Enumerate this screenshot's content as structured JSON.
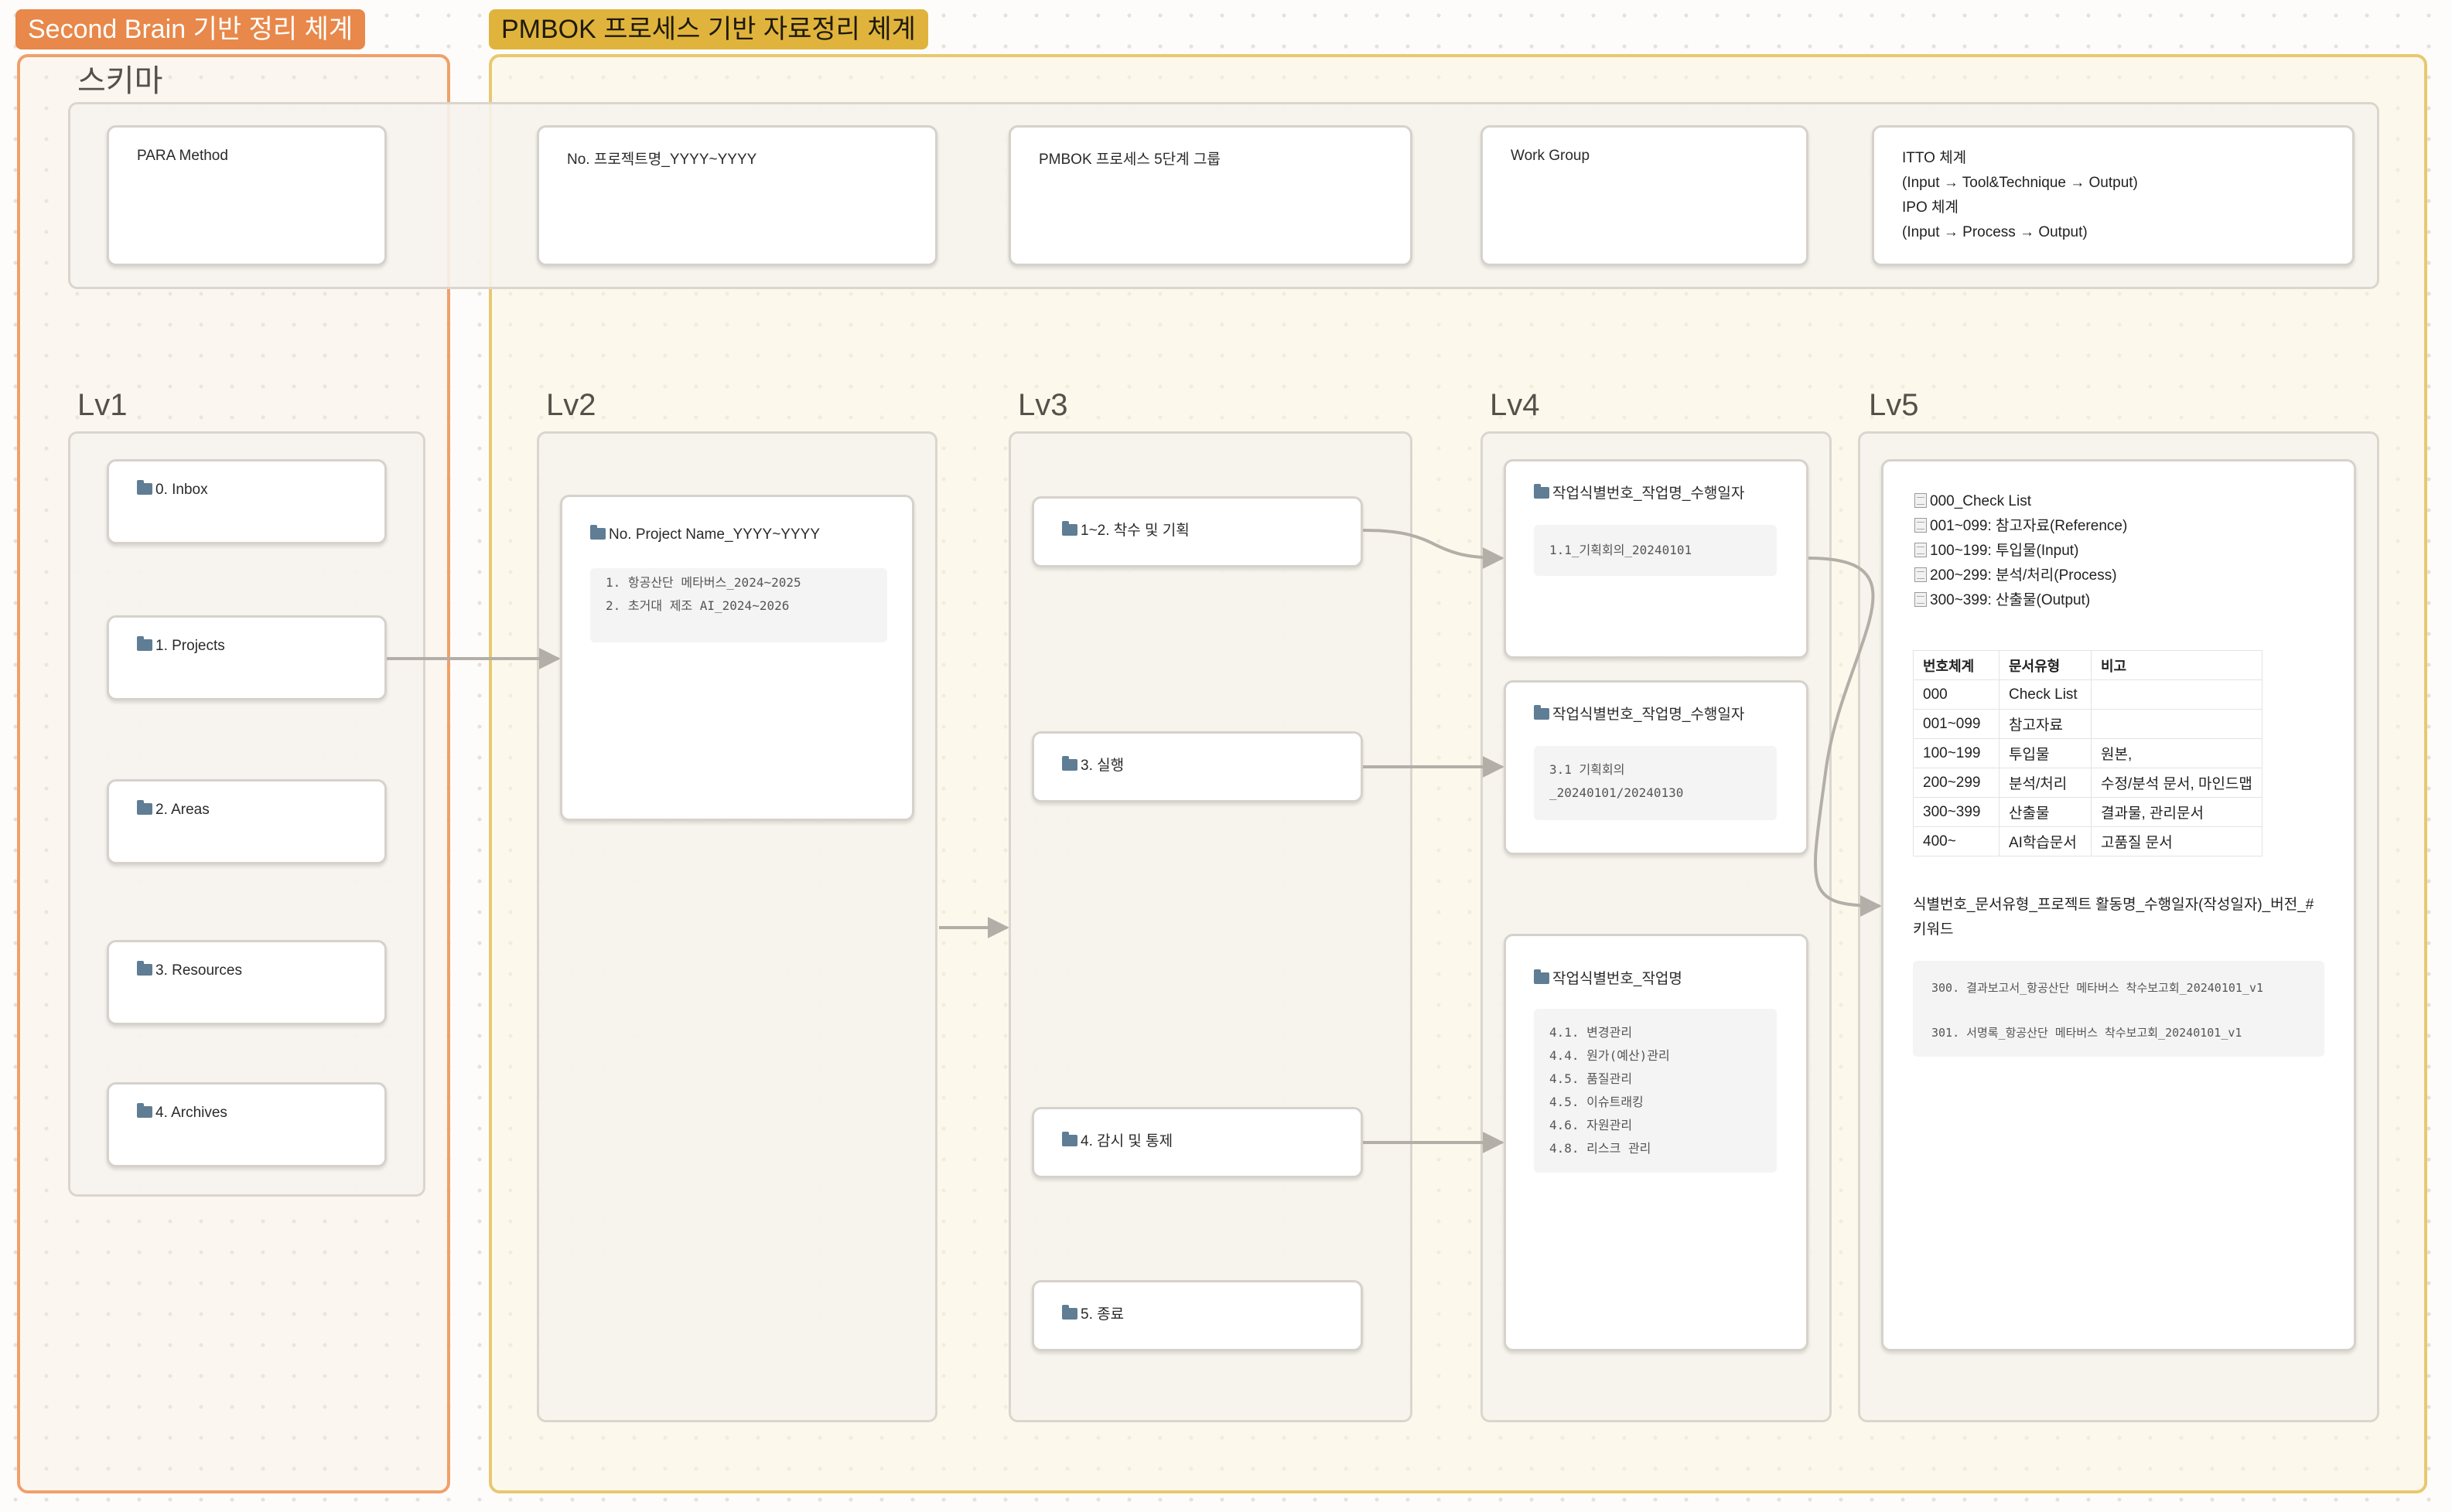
{
  "groups": {
    "second_brain": "Second Brain 기반 정리 체계",
    "pmbok": "PMBOK 프로세스 기반 자료정리 체계"
  },
  "schema": {
    "label": "스키마",
    "cards": [
      "PARA Method",
      "No. 프로젝트명_YYYY~YYYY",
      "PMBOK 프로세스 5단계 그룹",
      "Work Group"
    ],
    "itto": [
      "ITTO 체계",
      "(Input → Tool&Technique → Output)",
      "IPO 체계",
      "(Input → Process → Output)"
    ]
  },
  "lv1": {
    "label": "Lv1",
    "items": [
      "0. Inbox",
      "1. Projects",
      "2. Areas",
      "3. Resources",
      "4. Archives"
    ]
  },
  "lv2": {
    "label": "Lv2",
    "title": "No. Project Name_YYYY~YYYY",
    "list": [
      "1. 항공산단 메타버스_2024~2025",
      "2. 초거대 제조 AI_2024~2026"
    ]
  },
  "lv3": {
    "label": "Lv3",
    "items": [
      "1~2. 착수 및 기획",
      "3. 실행",
      "4. 감시 및 통제",
      "5. 종료"
    ]
  },
  "lv4": {
    "label": "Lv4",
    "cards": [
      {
        "title": "작업식별번호_작업명_수행일자",
        "lines": [
          "1.1_기획회의_20240101"
        ]
      },
      {
        "title": "작업식별번호_작업명_수행일자",
        "lines": [
          "3.1 기획회의",
          "_20240101/20240130"
        ]
      },
      {
        "title": "작업식별번호_작업명",
        "lines": [
          "4.1. 변경관리",
          "4.4. 원가(예산)관리",
          "4.5. 품질관리",
          "4.5. 이슈트래킹",
          "4.6. 자원관리",
          "4.8. 리스크 관리"
        ]
      }
    ]
  },
  "lv5": {
    "label": "Lv5",
    "checklist": [
      "000_Check List",
      "001~099: 참고자료(Reference)",
      "100~199: 투입물(Input)",
      "200~299: 분석/처리(Process)",
      "300~399: 산출물(Output)"
    ],
    "table": {
      "headers": [
        "번호체계",
        "문서유형",
        "비고"
      ],
      "rows": [
        [
          "000",
          "Check List",
          ""
        ],
        [
          "001~099",
          "참고자료",
          ""
        ],
        [
          "100~199",
          "투입물",
          "원본,"
        ],
        [
          "200~299",
          "분석/처리",
          "수정/분석 문서, 마인드맵"
        ],
        [
          "300~399",
          "산출물",
          "결과물, 관리문서"
        ],
        [
          "400~",
          "AI학습문서",
          "고품질 문서"
        ]
      ]
    },
    "naming": [
      "식별번호_문서유형_프로젝트 활동명_수행일자(작성일자)_버전_#",
      "키워드"
    ],
    "examples": [
      "300. 결과보고서_항공산단 메타버스 착수보고회_20240101_v1",
      "301. 서명록_항공산단 메타버스 착수보고회_20240101_v1"
    ]
  },
  "colors": {
    "orange_group": "#e8884a",
    "yellow_group": "#e0b43c",
    "edge": "#b3afa8"
  }
}
